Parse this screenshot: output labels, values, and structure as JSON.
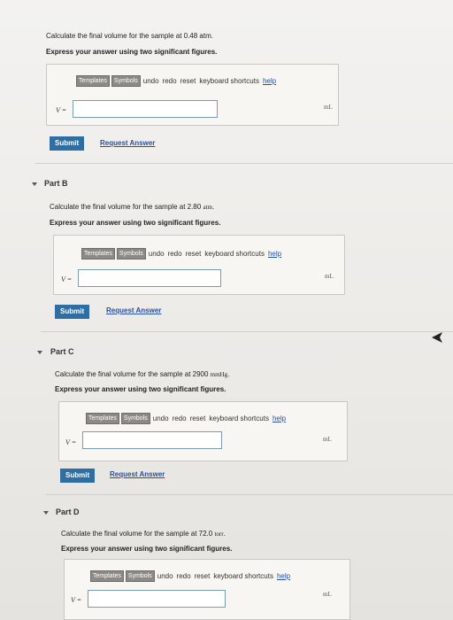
{
  "toolbar": {
    "templates": "Templates",
    "symbols": "Symbols",
    "undo": "undo",
    "redo": "redo",
    "reset": "reset",
    "shortcuts": "keyboard shortcuts",
    "help": "help"
  },
  "part_a": {
    "question": "Calculate the final volume for the sample at 0.48 atm.",
    "instruction": "Express your answer using two significant figures.",
    "var": "V =",
    "unit": "mL",
    "input_value": "",
    "submit": "Submit",
    "request": "Request Answer"
  },
  "part_b": {
    "label": "Part B",
    "question_prefix": "Calculate the final volume for the sample at 2.80",
    "question_unit": "atm",
    "instruction": "Express your answer using two significant figures.",
    "var": "V =",
    "unit": "mL",
    "input_value": "",
    "submit": "Submit",
    "request": "Request Answer"
  },
  "part_c": {
    "label": "Part C",
    "question_prefix": "Calculate the final volume for the sample at 2900",
    "question_unit": "mmHg",
    "instruction": "Express your answer using two significant figures.",
    "var": "V =",
    "unit": "mL",
    "input_value": "",
    "submit": "Submit",
    "request": "Request Answer"
  },
  "part_d": {
    "label": "Part D",
    "question_prefix": "Calculate the final volume for the sample at 72.0",
    "question_unit": "torr",
    "instruction": "Express your answer using two significant figures.",
    "var": "V =",
    "unit": "mL",
    "input_value": ""
  }
}
